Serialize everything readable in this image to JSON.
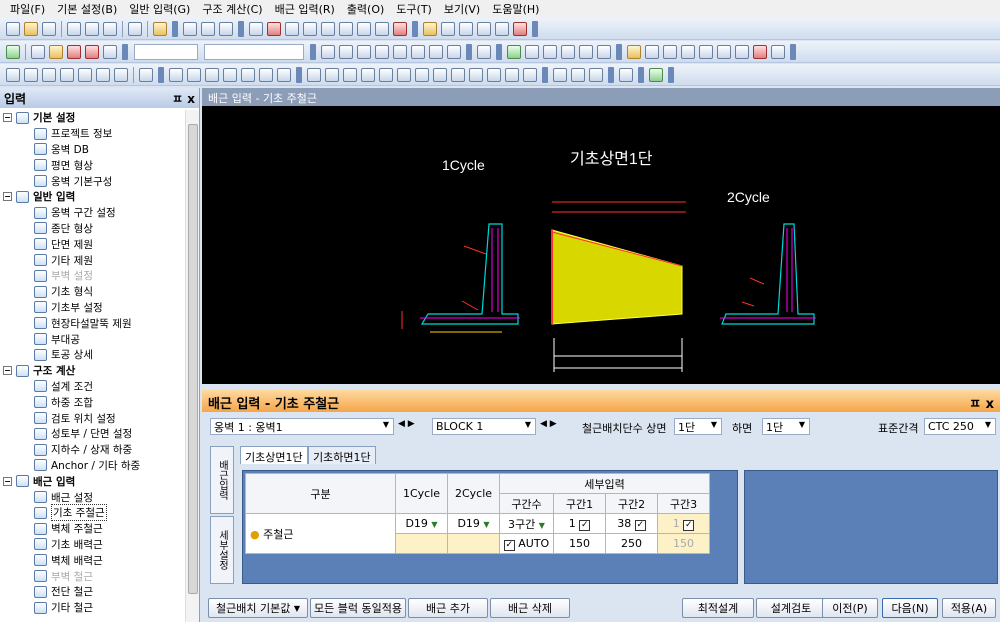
{
  "menu": [
    "파일(F)",
    "기본 설정(B)",
    "일반 입력(G)",
    "구조 계산(C)",
    "배근 입력(R)",
    "출력(O)",
    "도구(T)",
    "보기(V)",
    "도움말(H)"
  ],
  "left_panel": {
    "title": "입력",
    "pin": "ㅍ",
    "close": "x",
    "groups": [
      {
        "label": "기본 설정",
        "items": [
          "프로젝트 정보",
          "옹벽 DB",
          "평면 형상",
          "옹벽 기본구성"
        ]
      },
      {
        "label": "일반 입력",
        "items": [
          "옹벽 구간 설정",
          "종단 형상",
          "단면 제원",
          "기타 제원",
          "부벽 설정",
          "기초 형식",
          "기초부 설정",
          "현장타설말뚝 제원",
          "부대공",
          "토공 상세"
        ]
      },
      {
        "label": "구조 계산",
        "items": [
          "설계 조건",
          "하중 조합",
          "검토 위치 설정",
          "성토부 / 단면 설정",
          "지하수 / 상재 하중",
          "Anchor / 기타 하중"
        ]
      },
      {
        "label": "배근 입력",
        "items": [
          "배근 설정",
          "기초 주철근",
          "벽체 주철근",
          "기초 배력근",
          "벽체 배력근",
          "부벽 철근",
          "전단 철근",
          "기타 철근"
        ]
      }
    ],
    "disabled": [
      "부벽 설정",
      "부벽 철근"
    ],
    "selected": "기초 주철근"
  },
  "viewer": {
    "title": "배근 입력 - 기초 주철근",
    "labels": {
      "c1": "1Cycle",
      "main": "기초상면1단",
      "c2": "2Cycle"
    }
  },
  "bottom": {
    "title": "배근 입력 - 기초 주철근",
    "pin": "ㅍ",
    "close": "x",
    "wall_select": "옹벽 1 : 옹벽1",
    "block_select": "BLOCK  1",
    "layer_label": "철근배치단수 상면",
    "layer_top": "1단",
    "bottom_label": "하면",
    "layer_bottom": "1단",
    "std_label": "표준간격",
    "std_value": "CTC 250",
    "vtabs": [
      "배근입력",
      "세부설정"
    ],
    "tabs": [
      "기초상면1단",
      "기초하면1단"
    ],
    "table": {
      "h_gubun": "구분",
      "h_c1": "1Cycle",
      "h_c2": "2Cycle",
      "h_detail": "세부입력",
      "h_sec": "구간수",
      "h_s1": "구간1",
      "h_s2": "구간2",
      "h_s3": "구간3",
      "row_label": "주철근",
      "c1": "D19",
      "c2": "D19",
      "sec": "3구간",
      "s1": "1",
      "s2": "38",
      "s3": "1",
      "auto": "AUTO",
      "v1": "150",
      "v2": "250",
      "v3": "150"
    },
    "buttons": {
      "default": "철근배치 기본값",
      "same": "모든 블럭 동일적용",
      "add": "배근 추가",
      "del": "배근 삭제",
      "opt": "최적설계",
      "check": "설계검토",
      "prev": "이전(P)",
      "next": "다음(N)",
      "apply": "적용(A)"
    }
  }
}
